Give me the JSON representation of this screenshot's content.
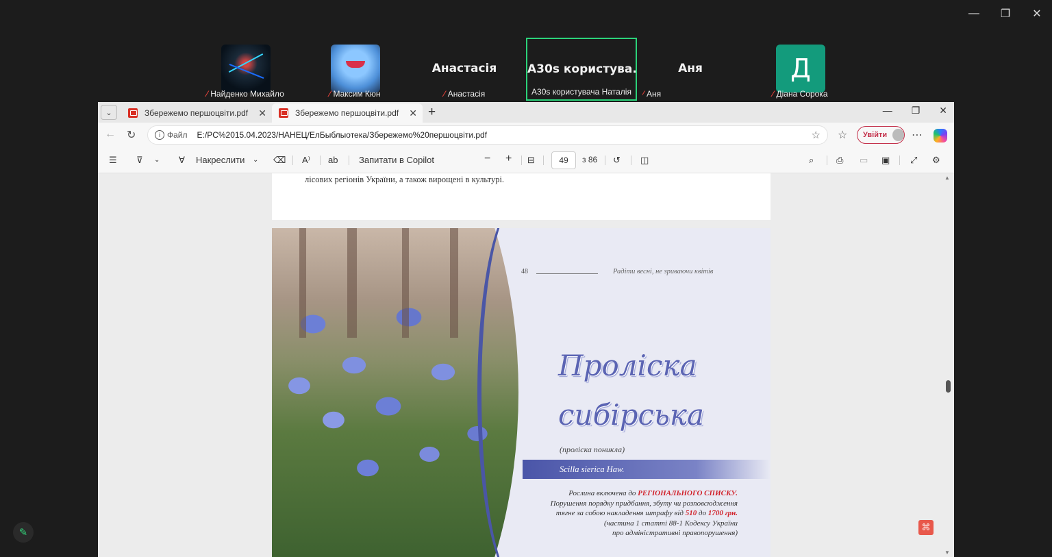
{
  "meeting": {
    "participants": [
      {
        "name": "Найденко Михайло",
        "display": "",
        "avatar": "neon-avatar",
        "muted": true
      },
      {
        "name": "Максим Кюн",
        "display": "",
        "avatar": "blue-monster-avatar",
        "muted": true
      },
      {
        "name": "Анастасія",
        "display": "Анастасія",
        "avatar": "",
        "muted": true
      },
      {
        "name": "A30s користувача Наталія",
        "display": "A30s користува...",
        "avatar": "",
        "muted": false,
        "active": true
      },
      {
        "name": "Аня",
        "display": "Аня",
        "avatar": "",
        "muted": true
      },
      {
        "name": "Діана Сорока",
        "display": "",
        "avatar_letter": "Д",
        "muted": true
      }
    ],
    "colors": {
      "active_border": "#2bd37a",
      "muted_icon": "#e0413a",
      "letter_avatar": "#139b7c"
    }
  },
  "browser": {
    "tabs": [
      {
        "title": "Збережемо першоцвіти.pdf"
      },
      {
        "title": "Збережемо першоцвіти.pdf"
      }
    ],
    "address": {
      "scheme_label": "Файл",
      "url": "E:/PC%2015.04.2023/НАНЕЦ/ЕлБыблыотека/Збережемо%20першоцвіти.pdf"
    },
    "signin_label": "Увійти"
  },
  "pdf_toolbar": {
    "draw_label": "Накреслити",
    "ask_copilot_label": "Запитати в Copilot",
    "page_number": "49",
    "page_total": "з 86"
  },
  "document": {
    "top_text": "лісових регіонів України, а також вирощені в культурі.",
    "page_number": "48",
    "motto": "Радіти весні, не зриваючи квітів",
    "title_line1": "Проліска",
    "title_line2": "сибірська",
    "subtitle": "(проліска поникла)",
    "latin_name": "Scilla sierica Haw.",
    "law": {
      "line1_prefix": "Рослина включена до ",
      "line1_red": "РЕГІОНАЛЬНОГО СПИСКУ.",
      "line2": "Порушення порядку придбання, збуту чи розповсюдження",
      "line3_prefix": "тягне за собою накладення штрафу від ",
      "fine_min": "510",
      "line3_mid": " до ",
      "fine_max": "1700 грн.",
      "line4": "(частина 1 статті 88-1 Кодексу України",
      "line5": "про адміністративні правопорушення)"
    }
  }
}
